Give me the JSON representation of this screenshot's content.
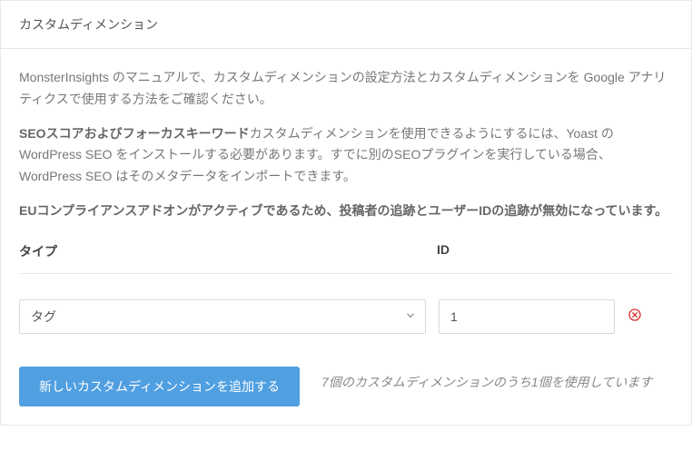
{
  "header": {
    "title": "カスタムディメンション"
  },
  "body": {
    "desc1": "MonsterInsights のマニュアルで、カスタムディメンションの設定方法とカスタムディメンションを Google アナリティクスで使用する方法をご確認ください。",
    "desc2_bold": "SEOスコアおよびフォーカスキーワード",
    "desc2_rest": "カスタムディメンションを使用できるようにするには、Yoast の WordPress SEO をインストールする必要があります。すでに別のSEOプラグインを実行している場合、WordPress SEO はそのメタデータをインポートできます。",
    "desc3_bold": "EUコンプライアンスアドオンがアクティブであるため、投稿者の追跡とユーザーIDの追跡が無効になっています。"
  },
  "table": {
    "headers": {
      "type": "タイプ",
      "id": "ID"
    },
    "rows": [
      {
        "type_selected": "タグ",
        "id_value": "1"
      }
    ]
  },
  "footer": {
    "add_label": "新しいカスタムディメンションを追加する",
    "usage_text": "7個のカスタムディメンションのうち1個を使用しています"
  },
  "colors": {
    "accent": "#509fe1",
    "danger": "#dc3232"
  }
}
